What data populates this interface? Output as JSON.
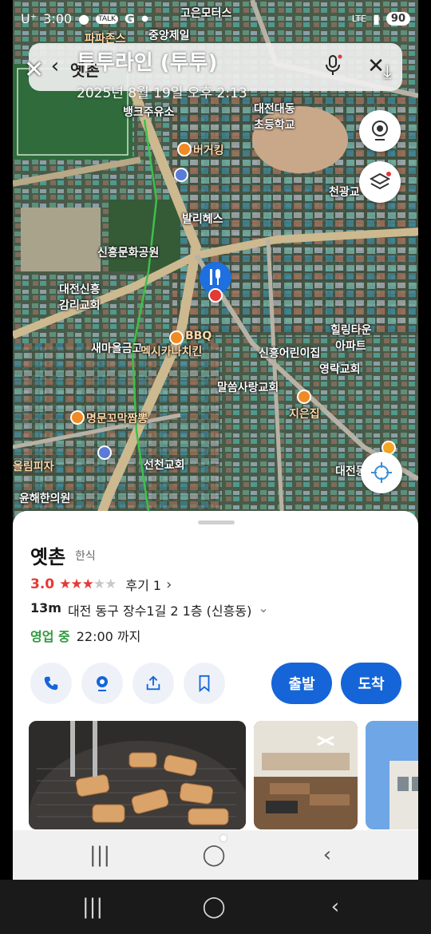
{
  "status_bar": {
    "carrier": "U⁺",
    "time": "3:00",
    "notification_icons": [
      "chat-bubble-icon",
      "talk-icon",
      "g-icon",
      "dot-icon"
    ],
    "network": "LTE",
    "battery": "90"
  },
  "overlay": {
    "title": "투투라인 (투투)",
    "date": "2025년 8월 19일 오후 2:13",
    "search_text": "옛촌"
  },
  "map_labels": {
    "l1": "고은모터스",
    "l2": "파파존스",
    "l3": "중앙제일",
    "l4": "뱅크주유소",
    "l5": "대전대동",
    "l6": "초등학교",
    "l7": "버거킹",
    "l8": "천광교",
    "l9": "발리헤스",
    "l10": "신흥문화공원",
    "l11": "대전신흥",
    "l12": "감리교회",
    "l13": "새마을금고",
    "l14": "BBQ",
    "l15": "힐링타운",
    "l16": "아파트",
    "l17": "신흥어린이집",
    "l18": "멕시카나치킨",
    "l19": "영락교회",
    "l20": "말씀사랑교회",
    "l21": "지은집",
    "l22": "명문꼬막짬뽕",
    "l23": "올림피자",
    "l24": "선천교회",
    "l25": "윤해한의원",
    "l26": "대전동구 54"
  },
  "place": {
    "name": "옛촌",
    "category": "한식",
    "rating": "3.0",
    "rating_stars_filled": 3,
    "reviews": "후기 1",
    "distance": "13m",
    "address": "대전 동구 장수1길 2 1층 (신흥동)",
    "status": "영업 중",
    "hours": "22:00 까지"
  },
  "actions": {
    "depart": "출발",
    "arrive": "도착"
  },
  "colors": {
    "accent": "#1565d8",
    "rating": "#e53935",
    "open": "#2e9a3e"
  }
}
